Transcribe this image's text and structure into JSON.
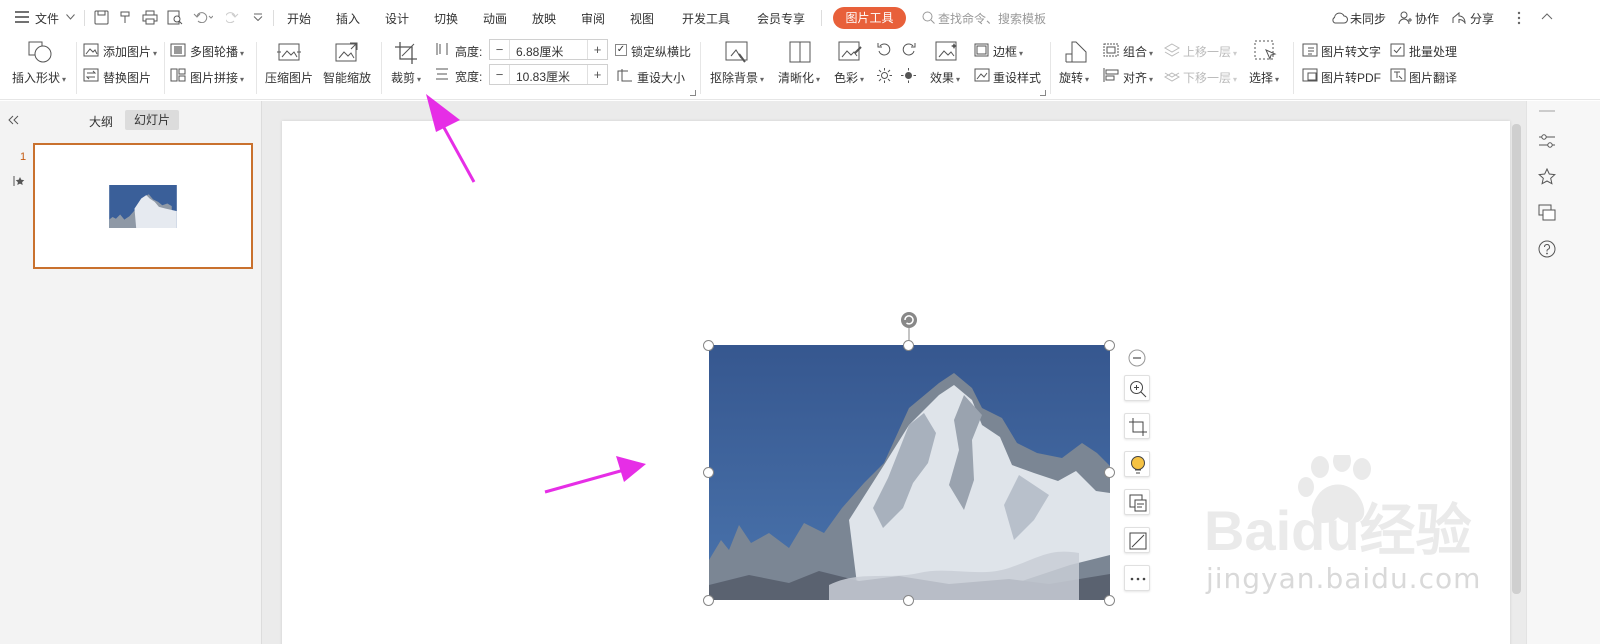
{
  "menubar": {
    "file_label": "文件",
    "tabs": [
      "开始",
      "插入",
      "设计",
      "切换",
      "动画",
      "放映",
      "审阅",
      "视图",
      "开发工具",
      "会员专享"
    ],
    "active_context_tab": "图片工具",
    "search_placeholder": "查找命令、搜索模板",
    "sync_label": "未同步",
    "collab_label": "协作",
    "share_label": "分享"
  },
  "ribbon": {
    "insert_shape": "插入形状",
    "add_picture": "添加图片",
    "replace_picture": "替换图片",
    "multi_carousel": "多图轮播",
    "picture_collage": "图片拼接",
    "compress_picture": "压缩图片",
    "smart_scale": "智能缩放",
    "crop": "裁剪",
    "height_label": "高度:",
    "height_value": "6.88厘米",
    "width_label": "宽度:",
    "width_value": "10.83厘米",
    "lock_ratio": "锁定纵横比",
    "reset_size": "重设大小",
    "remove_bg": "抠除背景",
    "sharpen": "清晰化",
    "color": "色彩",
    "effects": "效果",
    "border": "边框",
    "reset_style": "重设样式",
    "rotate": "旋转",
    "group": "组合",
    "align": "对齐",
    "bring_forward": "上移一层",
    "send_backward": "下移一层",
    "select": "选择",
    "pic_to_text": "图片转文字",
    "batch_process": "批量处理",
    "pic_to_pdf": "图片转PDF",
    "pic_translate": "图片翻译"
  },
  "leftpanel": {
    "tab_outline": "大纲",
    "tab_slides": "幻灯片",
    "slide_number": "1"
  },
  "watermark": {
    "brand": "Baidu经验",
    "url": "jingyan.baidu.com"
  },
  "colors": {
    "accent_tab": "#e8603a",
    "slide_selected_border": "#c9712e",
    "annotation_arrow": "#e62ee6",
    "sky": "#3a5f99"
  }
}
